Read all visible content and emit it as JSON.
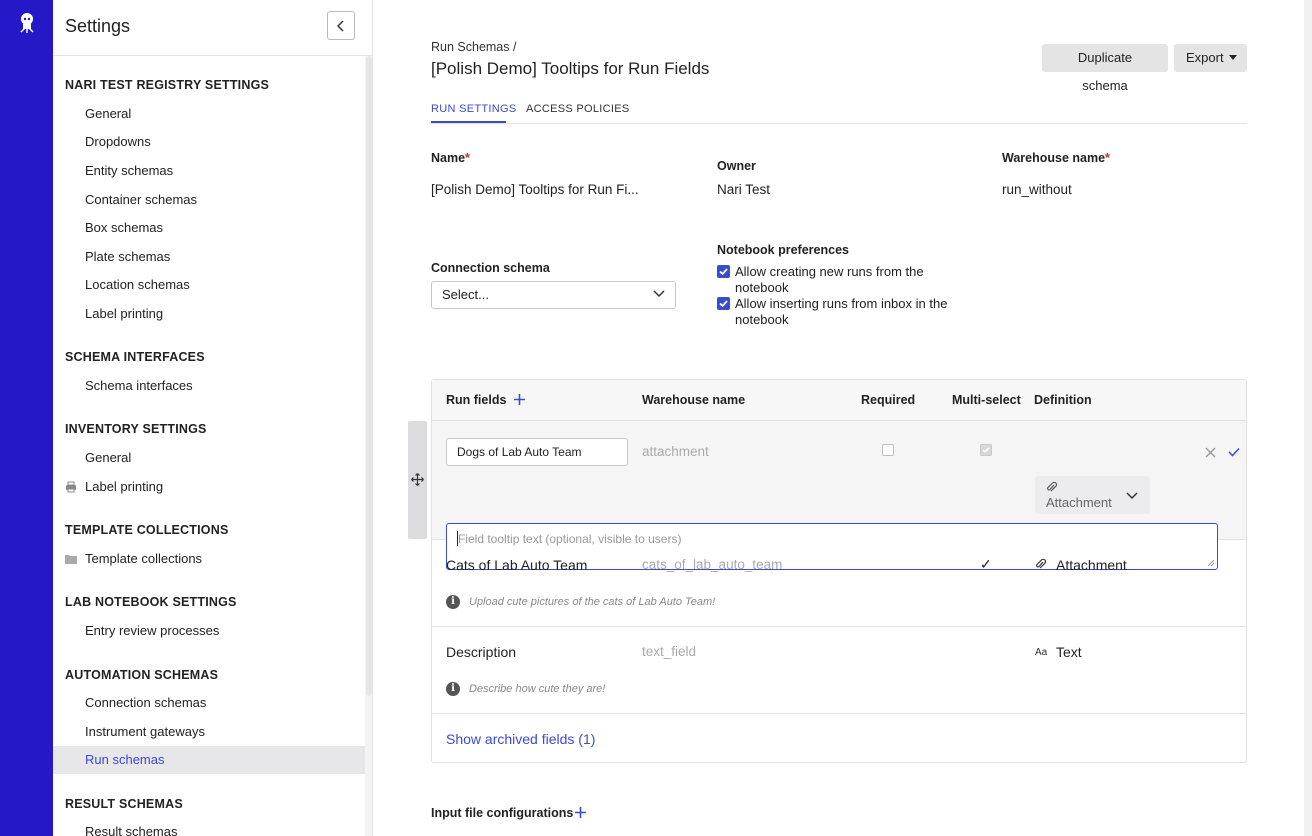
{
  "sidebar": {
    "title": "Settings",
    "sections": [
      {
        "title": "NARI TEST REGISTRY SETTINGS",
        "items": [
          "General",
          "Dropdowns",
          "Entity schemas",
          "Container schemas",
          "Box schemas",
          "Plate schemas",
          "Location schemas",
          "Label printing"
        ]
      },
      {
        "title": "SCHEMA INTERFACES",
        "items": [
          "Schema interfaces"
        ]
      },
      {
        "title": "INVENTORY SETTINGS",
        "items": [
          "General",
          "Label printing"
        ]
      },
      {
        "title": "TEMPLATE COLLECTIONS",
        "items": [
          "Template collections"
        ]
      },
      {
        "title": "LAB NOTEBOOK SETTINGS",
        "items": [
          "Entry review processes"
        ]
      },
      {
        "title": "AUTOMATION SCHEMAS",
        "items": [
          "Connection schemas",
          "Instrument gateways",
          "Run schemas"
        ]
      },
      {
        "title": "RESULT SCHEMAS",
        "items": [
          "Result schemas"
        ]
      }
    ]
  },
  "header": {
    "breadcrumb": "Run Schemas /",
    "title": "[Polish Demo] Tooltips for Run Fields",
    "duplicate_label": "Duplicate schema",
    "export_label": "Export"
  },
  "tabs": [
    "RUN SETTINGS",
    "ACCESS POLICIES"
  ],
  "form": {
    "name_label": "Name",
    "name_value": "[Polish Demo] Tooltips for Run Fi...",
    "owner_label": "Owner",
    "owner_value": "Nari Test",
    "warehouse_label": "Warehouse name",
    "warehouse_value": "run_without",
    "connection_label": "Connection schema",
    "connection_value": "Select...",
    "notebook_label": "Notebook preferences",
    "notebook_opt1_line1": "Allow creating new runs from the",
    "notebook_opt1_line2": "notebook",
    "notebook_opt2_line1": "Allow inserting runs from inbox in the",
    "notebook_opt2_line2": "notebook"
  },
  "fields_table": {
    "headers": {
      "name": "Run fields",
      "warehouse": "Warehouse name",
      "required": "Required",
      "multi": "Multi-select",
      "definition": "Definition"
    },
    "edit_row": {
      "name_value": "Dogs of Lab Auto Team",
      "warehouse": "attachment",
      "definition": "Attachment",
      "tooltip_placeholder": "Field tooltip text (optional, visible to users)"
    },
    "rows": [
      {
        "name": "Cats of Lab Auto Team",
        "warehouse": "cats_of_lab_auto_team",
        "multi": "✓",
        "definition": "Attachment",
        "hint": "Upload cute pictures of the cats of Lab Auto Team!"
      },
      {
        "name": "Description",
        "warehouse": "text_field",
        "definition_icon": "Aa",
        "definition": "Text",
        "hint": "Describe how cute they are!"
      }
    ],
    "archived_link": "Show archived fields (1)"
  },
  "input_files": {
    "label": "Input file configurations"
  },
  "colors": {
    "rail": "#2418c7",
    "accent": "#3b4bd1",
    "required": "#d02b2b"
  }
}
